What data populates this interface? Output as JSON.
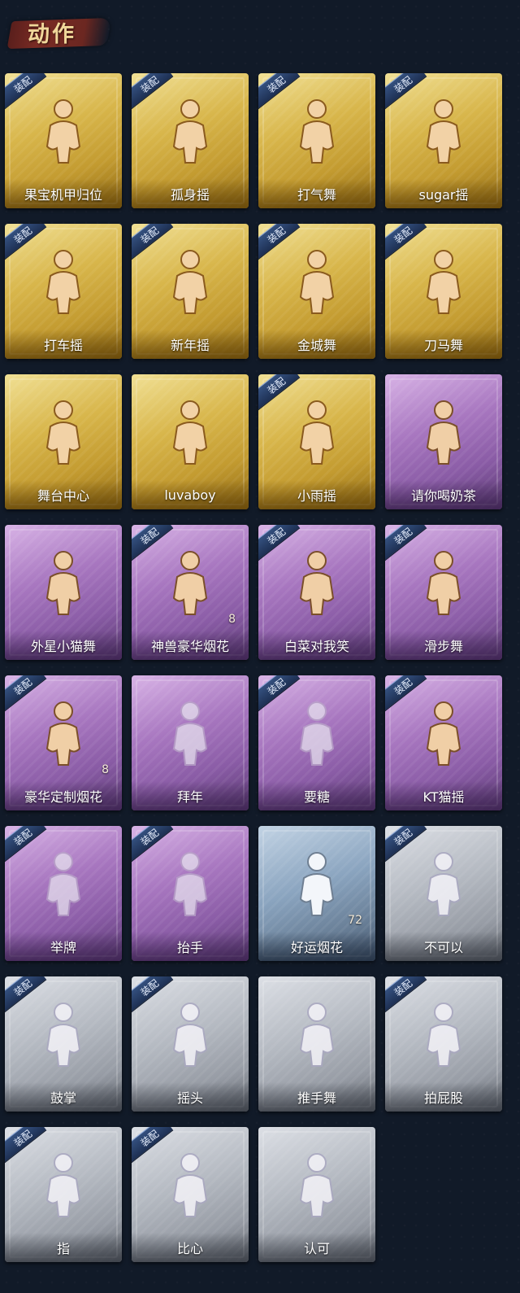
{
  "header": {
    "title": "动作"
  },
  "equip_label": "装配",
  "cards": [
    {
      "label": "果宝机甲归位",
      "tier": "gold",
      "equipped": true,
      "count": ""
    },
    {
      "label": "孤身摇",
      "tier": "gold",
      "equipped": true,
      "count": ""
    },
    {
      "label": "打气舞",
      "tier": "gold",
      "equipped": true,
      "count": ""
    },
    {
      "label": "sugar摇",
      "tier": "gold",
      "equipped": true,
      "count": ""
    },
    {
      "label": "打车摇",
      "tier": "gold",
      "equipped": true,
      "count": ""
    },
    {
      "label": "新年摇",
      "tier": "gold",
      "equipped": true,
      "count": ""
    },
    {
      "label": "金城舞",
      "tier": "gold",
      "equipped": true,
      "count": ""
    },
    {
      "label": "刀马舞",
      "tier": "gold",
      "equipped": true,
      "count": ""
    },
    {
      "label": "舞台中心",
      "tier": "gold",
      "equipped": false,
      "count": ""
    },
    {
      "label": "luvaboy",
      "tier": "gold",
      "equipped": false,
      "count": ""
    },
    {
      "label": "小雨摇",
      "tier": "gold",
      "equipped": true,
      "count": ""
    },
    {
      "label": "请你喝奶茶",
      "tier": "purple",
      "equipped": false,
      "count": ""
    },
    {
      "label": "外星小猫舞",
      "tier": "purple",
      "equipped": false,
      "count": ""
    },
    {
      "label": "神兽豪华烟花",
      "tier": "purple",
      "equipped": true,
      "count": "8"
    },
    {
      "label": "白菜对我笑",
      "tier": "purple",
      "equipped": true,
      "count": ""
    },
    {
      "label": "滑步舞",
      "tier": "purple",
      "equipped": true,
      "count": ""
    },
    {
      "label": "豪华定制烟花",
      "tier": "purple",
      "equipped": true,
      "count": "8"
    },
    {
      "label": "拜年",
      "tier": "purple dim",
      "equipped": false,
      "count": ""
    },
    {
      "label": "要糖",
      "tier": "purple dim",
      "equipped": true,
      "count": ""
    },
    {
      "label": "KT猫摇",
      "tier": "purple",
      "equipped": true,
      "count": ""
    },
    {
      "label": "举牌",
      "tier": "purple dim",
      "equipped": true,
      "count": ""
    },
    {
      "label": "抬手",
      "tier": "purple dim",
      "equipped": true,
      "count": ""
    },
    {
      "label": "好运烟花",
      "tier": "blue",
      "equipped": false,
      "count": "72"
    },
    {
      "label": "不可以",
      "tier": "gray",
      "equipped": true,
      "count": ""
    },
    {
      "label": "鼓掌",
      "tier": "gray",
      "equipped": true,
      "count": ""
    },
    {
      "label": "摇头",
      "tier": "gray",
      "equipped": true,
      "count": ""
    },
    {
      "label": "推手舞",
      "tier": "gray",
      "equipped": false,
      "count": ""
    },
    {
      "label": "拍屁股",
      "tier": "gray",
      "equipped": true,
      "count": ""
    },
    {
      "label": "指",
      "tier": "gray",
      "equipped": true,
      "count": ""
    },
    {
      "label": "比心",
      "tier": "gray",
      "equipped": true,
      "count": ""
    },
    {
      "label": "认可",
      "tier": "gray",
      "equipped": false,
      "count": ""
    }
  ]
}
